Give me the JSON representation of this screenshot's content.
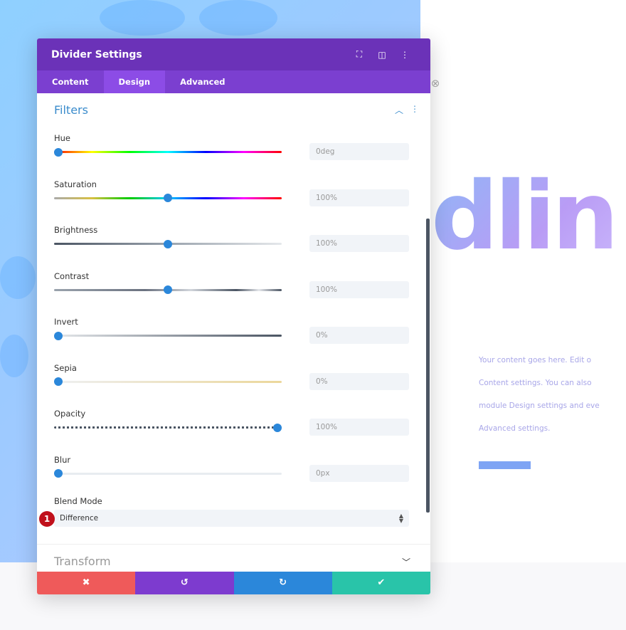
{
  "panel": {
    "title": "Divider Settings",
    "header_icons": [
      "focus-icon",
      "split-view-icon",
      "more-icon"
    ],
    "tabs": [
      {
        "label": "Content"
      },
      {
        "label": "Design"
      },
      {
        "label": "Advanced"
      }
    ],
    "active_tab": "Design"
  },
  "filters": {
    "title": "Filters",
    "items": [
      {
        "label": "Hue",
        "value": "0deg",
        "level": 0
      },
      {
        "label": "Saturation",
        "value": "100%",
        "level": 0.5
      },
      {
        "label": "Brightness",
        "value": "100%",
        "level": 0.5
      },
      {
        "label": "Contrast",
        "value": "100%",
        "level": 0.5
      },
      {
        "label": "Invert",
        "value": "0%",
        "level": 0
      },
      {
        "label": "Sepia",
        "value": "0%",
        "level": 0
      },
      {
        "label": "Opacity",
        "value": "100%",
        "level": 1
      },
      {
        "label": "Blur",
        "value": "0px",
        "level": 0
      }
    ],
    "blend_mode": {
      "label": "Blend Mode",
      "value": "Difference"
    },
    "badge": "1"
  },
  "transform": {
    "title": "Transform"
  },
  "footer": {
    "cancel": "✖",
    "undo": "↺",
    "redo": "↻",
    "save": "✔"
  },
  "preview": {
    "heading": "dlin",
    "paragraph": [
      "Your content goes here. Edit o",
      "Content settings. You can also",
      "module Design settings and eve",
      "Advanced settings."
    ]
  },
  "colors": {
    "header": "#6b32b8",
    "tabs": "#7b3fd0",
    "accent": "#2b87da",
    "cancel": "#ef5a5a",
    "undo": "#7d3bcf",
    "redo": "#2b87da",
    "save": "#29c4a9"
  }
}
